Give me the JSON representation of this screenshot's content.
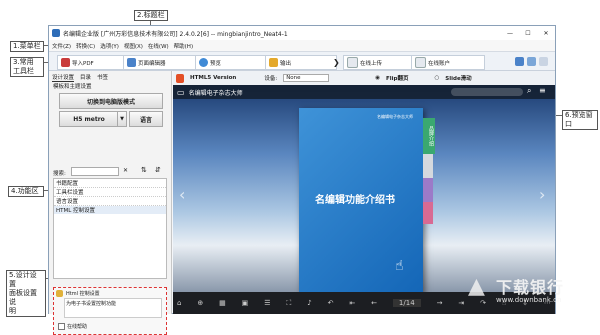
{
  "callouts": {
    "title_bar": "2.标题栏",
    "menu_bar": "1.菜单栏",
    "toolbar": "3.常用\n工具栏",
    "function_area": "4.功能区",
    "preview": "6.预览窗口",
    "design_settings": "5.设计设置\n面板设置说\n明"
  },
  "window": {
    "title": "名编辑企业版 [广州万彩信息技术有限公司] 2.4.0.2[6] -- mingbianjintro_Neat4-1",
    "min": "—",
    "max": "☐",
    "close": "✕"
  },
  "menu": [
    "文件(Z)",
    "转换(C)",
    "选项(Y)",
    "视图(X)",
    "在线(W)",
    "帮助(H)"
  ],
  "toolbar": {
    "import_pdf": "导入PDF",
    "page_editor": "页面编辑器",
    "theme": "预览",
    "output": "输出",
    "upload": "在线上传",
    "online_account": "在线账户",
    "arrow": "❯"
  },
  "panel": {
    "tabs": [
      "设计设置",
      "目录",
      "书签"
    ],
    "template_label": "模板和主题设置",
    "switch_mode": "切换到电脑版模式",
    "html_mode": "H5 metro",
    "language": "语言",
    "search_label": "搜索:",
    "tree": [
      "书籍配置",
      "工具栏设置",
      "语言设置",
      "HTML 控制设置"
    ],
    "help_title": "Html 控制设置",
    "help_text": "为电子书设置控制功能",
    "online_help": "在线帮助"
  },
  "preview_top": {
    "version": "HTML5 Version",
    "device_label": "设备:",
    "device": "None",
    "flip": "Flip翻页",
    "slide": "Slide滑动"
  },
  "book_app": {
    "brand": "名编辑电子杂志大师",
    "cover_title": "名编辑功能介绍书",
    "cover_brand": "名编辑电子杂志大师",
    "tabs": [
      "品牌介绍",
      "",
      "",
      ""
    ],
    "page_indicator": "1/14"
  },
  "watermark": {
    "text": "下载银行",
    "url": "www.downbank.cn"
  },
  "colors": {
    "book_blue": "#1466b7",
    "tab_green": "#3aa870",
    "tab_purple": "#9c7ac8",
    "tab_pink": "#d86a93"
  }
}
